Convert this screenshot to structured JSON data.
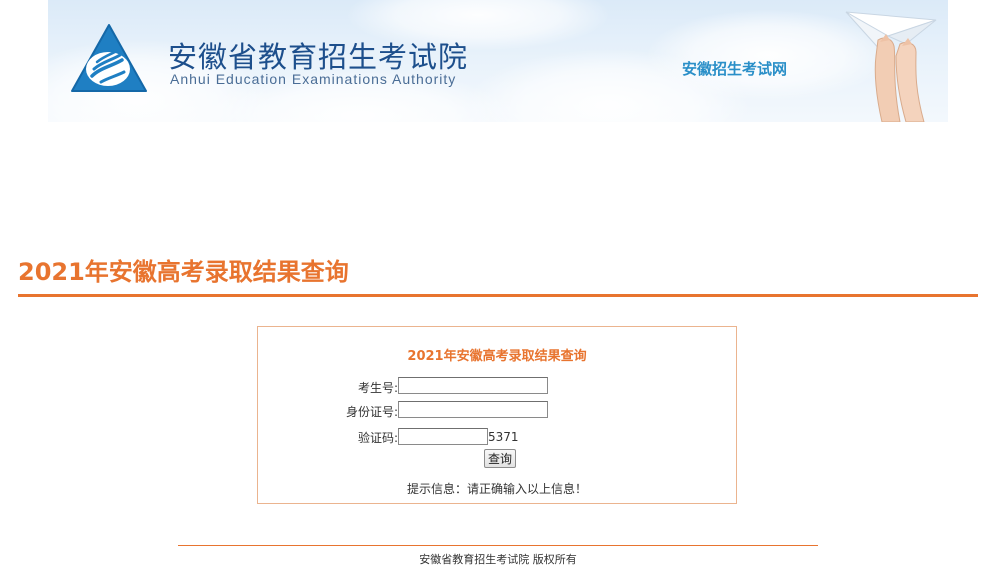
{
  "banner": {
    "org_name": "安徽省教育招生考试院",
    "org_name_en": "Anhui Education Examinations Authority",
    "site_name": "安徽招生考试网",
    "logo_icon": "aeea-triangle-logo-icon",
    "decoration_icon": "paper-plane-hands-icon"
  },
  "page": {
    "title": "2021年安徽高考录取结果查询"
  },
  "form": {
    "title": "2021年安徽高考录取结果查询",
    "exam_number_label": "考生号:",
    "exam_number_value": "",
    "id_number_label": "身份证号:",
    "id_number_value": "",
    "captcha_label": "验证码:",
    "captcha_value": "",
    "captcha_code": "5371",
    "submit_label": "查询",
    "hint": "提示信息：请正确输入以上信息！"
  },
  "footer": {
    "copyright": "安徽省教育招生考试院 版权所有"
  },
  "colors": {
    "accent": "#e8742f",
    "banner_text": "#1d4f8c",
    "site_name": "#2a8fc8"
  }
}
